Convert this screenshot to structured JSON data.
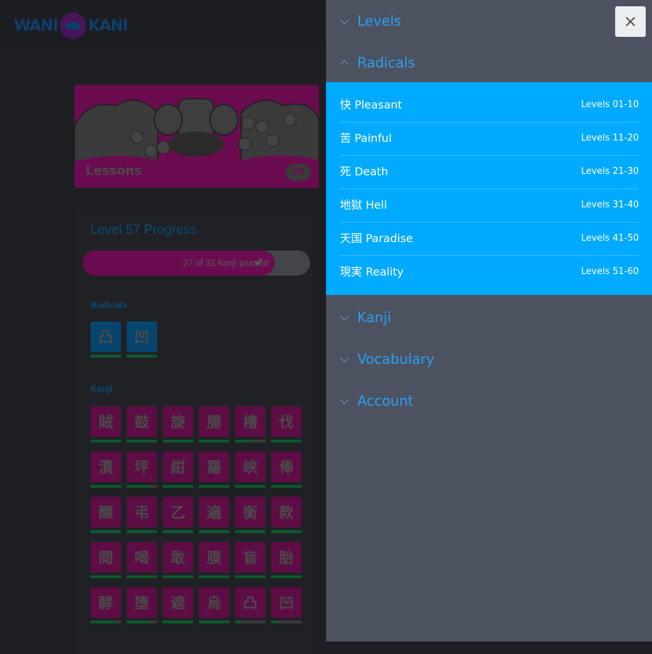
{
  "logo": {
    "left_text": "WANI",
    "right_text": "KANI"
  },
  "lessons": {
    "label": "Lessons",
    "count": "39"
  },
  "progress": {
    "title": "Level 57 Progress",
    "bar_text": "27 of 32 kanji passed",
    "passed": 27,
    "total": 32
  },
  "radicals_section": {
    "label": "Radicals",
    "items": [
      {
        "char": "凸",
        "srs_fill": 1.0
      },
      {
        "char": "凹",
        "srs_fill": 1.0
      }
    ]
  },
  "kanji_section": {
    "label": "Kanji",
    "items": [
      {
        "char": "賊",
        "srs_fill": 1.0
      },
      {
        "char": "鼓",
        "srs_fill": 1.0
      },
      {
        "char": "旋",
        "srs_fill": 1.0
      },
      {
        "char": "腸",
        "srs_fill": 1.0
      },
      {
        "char": "槽",
        "srs_fill": 0.6
      },
      {
        "char": "伐",
        "srs_fill": 1.0
      },
      {
        "char": "漬",
        "srs_fill": 1.0
      },
      {
        "char": "坪",
        "srs_fill": 0.8
      },
      {
        "char": "紺",
        "srs_fill": 1.0
      },
      {
        "char": "羅",
        "srs_fill": 1.0
      },
      {
        "char": "峡",
        "srs_fill": 1.0
      },
      {
        "char": "俸",
        "srs_fill": 1.0
      },
      {
        "char": "醸",
        "srs_fill": 1.0
      },
      {
        "char": "弔",
        "srs_fill": 1.0
      },
      {
        "char": "乙",
        "srs_fill": 1.0
      },
      {
        "char": "遍",
        "srs_fill": 1.0
      },
      {
        "char": "衡",
        "srs_fill": 1.0
      },
      {
        "char": "款",
        "srs_fill": 1.0
      },
      {
        "char": "閲",
        "srs_fill": 1.0
      },
      {
        "char": "喝",
        "srs_fill": 1.0
      },
      {
        "char": "敢",
        "srs_fill": 1.0
      },
      {
        "char": "膜",
        "srs_fill": 1.0
      },
      {
        "char": "盲",
        "srs_fill": 1.0
      },
      {
        "char": "胎",
        "srs_fill": 1.0
      },
      {
        "char": "酵",
        "srs_fill": 0.8
      },
      {
        "char": "堕",
        "srs_fill": 0.8
      },
      {
        "char": "遮",
        "srs_fill": 1.0
      },
      {
        "char": "烏",
        "srs_fill": 1.0
      },
      {
        "char": "凸",
        "srs_fill": 0.2
      },
      {
        "char": "凹",
        "srs_fill": 0.2
      }
    ]
  },
  "drawer": {
    "menu": [
      {
        "label": "Levels",
        "expanded": false
      },
      {
        "label": "Radicals",
        "expanded": true
      },
      {
        "label": "Kanji",
        "expanded": false
      },
      {
        "label": "Vocabulary",
        "expanded": false
      },
      {
        "label": "Account",
        "expanded": false
      }
    ],
    "radicals_submenu": [
      {
        "name": "快 Pleasant",
        "levels": "Levels 01-10"
      },
      {
        "name": "苦 Painful",
        "levels": "Levels 11-20"
      },
      {
        "name": "死 Death",
        "levels": "Levels 21-30"
      },
      {
        "name": "地獄 Hell",
        "levels": "Levels 31-40"
      },
      {
        "name": "天国 Paradise",
        "levels": "Levels 41-50"
      },
      {
        "name": "現実 Reality",
        "levels": "Levels 51-60"
      }
    ],
    "close_icon": "close-icon"
  },
  "colors": {
    "accent_blue": "#00aaff",
    "drawer_bg": "#4d5261",
    "menu_text": "#2aa0f0",
    "kanji_pink": "#5e0c45",
    "radical_blue": "#06456d"
  }
}
